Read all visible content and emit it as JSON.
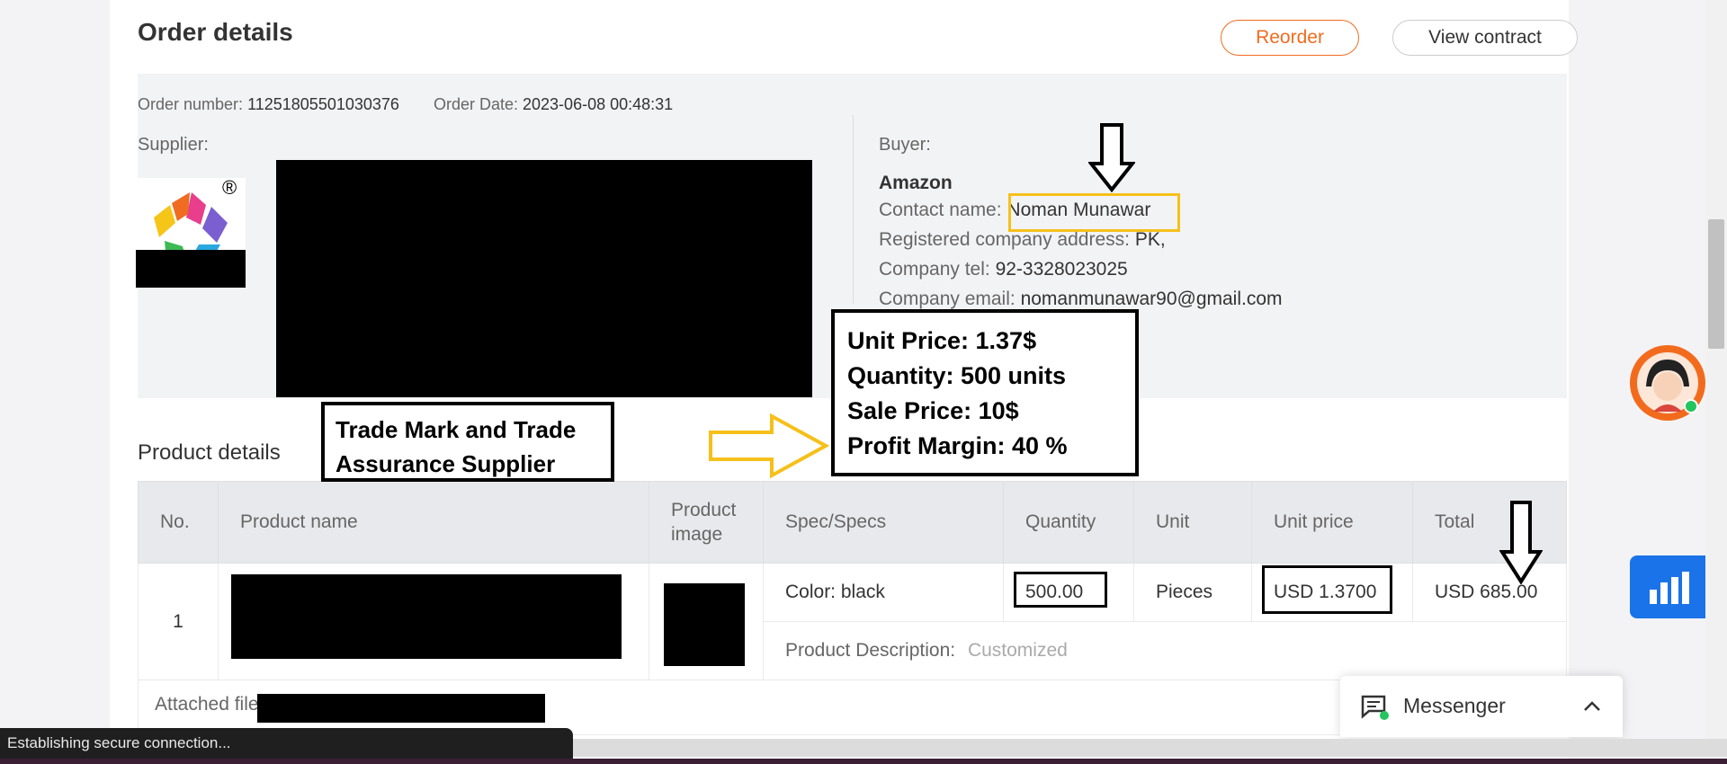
{
  "header": {
    "title": "Order details",
    "reorder_label": "Reorder",
    "contract_label": "View contract"
  },
  "order": {
    "number_label": "Order number:",
    "number": "11251805501030376",
    "date_label": "Order Date:",
    "date": "2023-06-08 00:48:31"
  },
  "supplier": {
    "label": "Supplier:"
  },
  "buyer": {
    "label": "Buyer:",
    "company": "Amazon",
    "contact_label": "Contact name:",
    "contact": "Noman Munawar",
    "address_label": "Registered company address:",
    "address": "PK,",
    "tel_label": "Company tel:",
    "tel": "92-3328023025",
    "email_label": "Company email:",
    "email": "nomanmunawar90@gmail.com"
  },
  "annotations": {
    "trade": {
      "line1": "Trade Mark and Trade",
      "line2": "Assurance Supplier"
    },
    "pricing": {
      "line1": "Unit Price: 1.37$",
      "line2": "Quantity: 500 units",
      "line3": "Sale Price: 10$",
      "line4": "Profit Margin: 40 %"
    }
  },
  "product_section": {
    "title": "Product details",
    "columns": [
      "No.",
      "Product name",
      "Product image",
      "Spec/Specs",
      "Quantity",
      "Unit",
      "Unit price",
      "Total"
    ],
    "row": {
      "no": "1",
      "spec": "Color: black",
      "quantity": "500.00",
      "unit": "Pieces",
      "unit_price": "USD 1.3700",
      "total": "USD 685.00",
      "description_label": "Product Description:",
      "description_value": "Customized"
    }
  },
  "attached": {
    "label": "Attached files"
  },
  "messenger": {
    "label": "Messenger"
  },
  "status": {
    "text": "Establishing secure connection..."
  },
  "colors": {
    "accent": "#f06c20",
    "highlight_yellow": "#f6c01a",
    "blue": "#1a73e8"
  },
  "icons": [
    "registered-icon",
    "arrow-down-icon",
    "arrow-right-icon",
    "chat-icon",
    "chevron-up-icon",
    "bar-chart-icon",
    "support-avatar-icon"
  ]
}
